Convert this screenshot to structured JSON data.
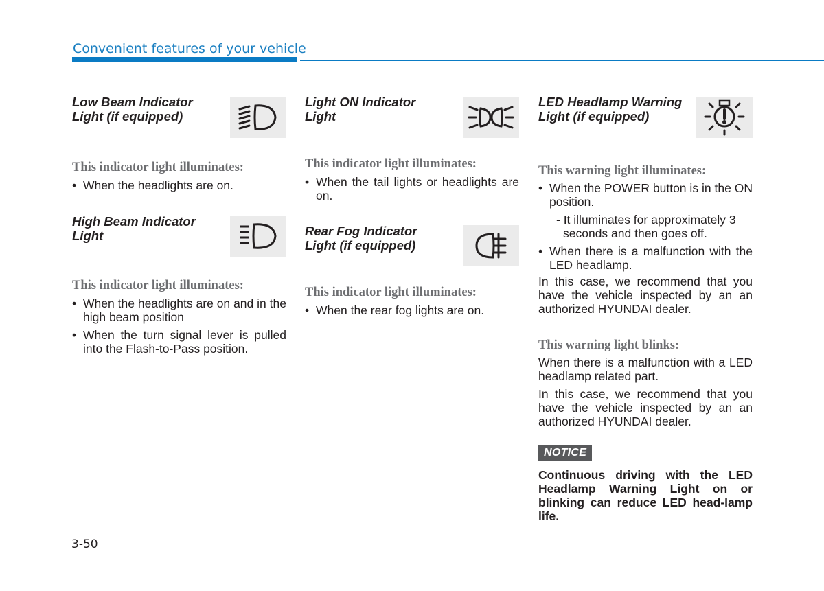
{
  "header": {
    "title": "Convenient features of your vehicle",
    "accent_color": "#0a7bc4"
  },
  "columns": [
    {
      "sections": [
        {
          "title_line1": "Low Beam Indicator",
          "title_line2": "Light (if equipped)",
          "icon": "low-beam-icon",
          "subheading": "This indicator light illuminates:",
          "bullets": [
            "When the headlights are on."
          ]
        },
        {
          "title_line1": "High Beam Indicator",
          "title_line2": "Light",
          "icon": "high-beam-icon",
          "subheading": "This indicator light illuminates:",
          "bullets": [
            "When the headlights are on and in the high beam position",
            "When the turn signal lever is pulled into the Flash-to-Pass position."
          ]
        }
      ]
    },
    {
      "sections": [
        {
          "title_line1": "Light ON Indicator",
          "title_line2": "Light",
          "icon": "light-on-icon",
          "subheading": "This indicator light illuminates:",
          "bullets": [
            "When the tail lights or headlights are on."
          ]
        },
        {
          "title_line1": "Rear Fog Indicator",
          "title_line2": "Light (if equipped)",
          "icon": "rear-fog-icon",
          "subheading": "This indicator light illuminates:",
          "bullets": [
            "When the rear fog lights are on."
          ]
        }
      ]
    },
    {
      "sections": [
        {
          "title_line1": "LED Headlamp Warning",
          "title_line2": "Light (if equipped)",
          "icon": "led-headlamp-warning-icon",
          "subheading": "This warning light illuminates:",
          "bullets": [
            "When the POWER button is in the ON position.",
            "When there is a malfunction with the LED headlamp."
          ],
          "sub_bullet": "- It illuminates for approximately 3 seconds and then goes off.",
          "paragraph": "In this case, we recommend that you have the vehicle inspected by an an authorized HYUNDAI dealer.",
          "subheading2": "This warning light blinks:",
          "paragraph2": "When there is a malfunction with a LED headlamp related part.",
          "paragraph3": "In this case, we recommend that you have the vehicle inspected by an an authorized HYUNDAI dealer.",
          "notice_label": "NOTICE",
          "notice_text": "Continuous driving with the LED Headlamp Warning Light on or blinking can reduce LED head-lamp life."
        }
      ]
    }
  ],
  "footer": {
    "page_number": "3-50"
  }
}
